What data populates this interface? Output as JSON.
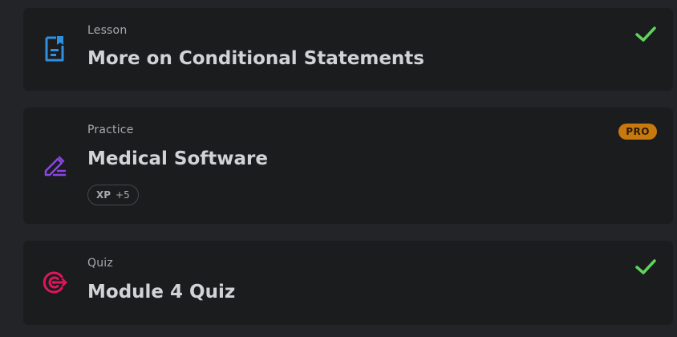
{
  "items": [
    {
      "type": "Lesson",
      "title": "More on Conditional Statements",
      "icon": "lesson-document-icon",
      "icon_color": "#2f8fe0",
      "status": "completed"
    },
    {
      "type": "Practice",
      "title": "Medical Software",
      "icon": "pencil-icon",
      "icon_color": "#8a45e6",
      "badge": "PRO",
      "xp_label": "XP",
      "xp_value": "+5"
    },
    {
      "type": "Quiz",
      "title": "Module 4 Quiz",
      "icon": "target-icon",
      "icon_color": "#e0155a",
      "status": "completed"
    }
  ],
  "colors": {
    "check": "#5fd35c",
    "pro_badge": "#c8790e",
    "card_bg": "#1b1c1e",
    "page_bg": "#232427"
  }
}
